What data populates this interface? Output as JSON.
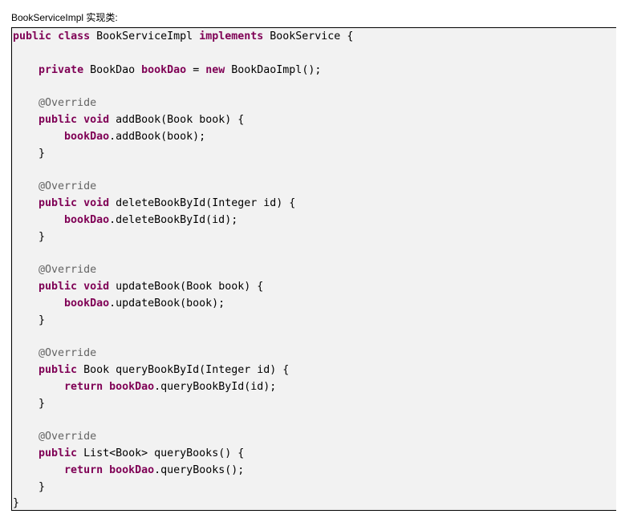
{
  "caption": "BookServiceImpl 实现类:",
  "code": {
    "lines": [
      [
        {
          "t": "public",
          "c": "kw"
        },
        {
          "t": " ",
          "c": "pl"
        },
        {
          "t": "class",
          "c": "kw"
        },
        {
          "t": " BookServiceImpl ",
          "c": "pl"
        },
        {
          "t": "implements",
          "c": "kw"
        },
        {
          "t": " BookService {",
          "c": "pl"
        }
      ],
      [],
      [
        {
          "t": "    ",
          "c": "pl"
        },
        {
          "t": "private",
          "c": "kw"
        },
        {
          "t": " BookDao ",
          "c": "pl"
        },
        {
          "t": "bookDao",
          "c": "fld"
        },
        {
          "t": " = ",
          "c": "pl"
        },
        {
          "t": "new",
          "c": "kw"
        },
        {
          "t": " BookDaoImpl();",
          "c": "pl"
        }
      ],
      [],
      [
        {
          "t": "    ",
          "c": "pl"
        },
        {
          "t": "@Override",
          "c": "ann"
        }
      ],
      [
        {
          "t": "    ",
          "c": "pl"
        },
        {
          "t": "public",
          "c": "kw"
        },
        {
          "t": " ",
          "c": "pl"
        },
        {
          "t": "void",
          "c": "kw"
        },
        {
          "t": " addBook(Book book) {",
          "c": "pl"
        }
      ],
      [
        {
          "t": "        ",
          "c": "pl"
        },
        {
          "t": "bookDao",
          "c": "fld"
        },
        {
          "t": ".addBook(book);",
          "c": "pl"
        }
      ],
      [
        {
          "t": "    }",
          "c": "pl"
        }
      ],
      [],
      [
        {
          "t": "    ",
          "c": "pl"
        },
        {
          "t": "@Override",
          "c": "ann"
        }
      ],
      [
        {
          "t": "    ",
          "c": "pl"
        },
        {
          "t": "public",
          "c": "kw"
        },
        {
          "t": " ",
          "c": "pl"
        },
        {
          "t": "void",
          "c": "kw"
        },
        {
          "t": " deleteBookById(Integer id) {",
          "c": "pl"
        }
      ],
      [
        {
          "t": "        ",
          "c": "pl"
        },
        {
          "t": "bookDao",
          "c": "fld"
        },
        {
          "t": ".deleteBookById(id);",
          "c": "pl"
        }
      ],
      [
        {
          "t": "    }",
          "c": "pl"
        }
      ],
      [],
      [
        {
          "t": "    ",
          "c": "pl"
        },
        {
          "t": "@Override",
          "c": "ann"
        }
      ],
      [
        {
          "t": "    ",
          "c": "pl"
        },
        {
          "t": "public",
          "c": "kw"
        },
        {
          "t": " ",
          "c": "pl"
        },
        {
          "t": "void",
          "c": "kw"
        },
        {
          "t": " updateBook(Book book) {",
          "c": "pl"
        }
      ],
      [
        {
          "t": "        ",
          "c": "pl"
        },
        {
          "t": "bookDao",
          "c": "fld"
        },
        {
          "t": ".updateBook(book);",
          "c": "pl"
        }
      ],
      [
        {
          "t": "    }",
          "c": "pl"
        }
      ],
      [],
      [
        {
          "t": "    ",
          "c": "pl"
        },
        {
          "t": "@Override",
          "c": "ann"
        }
      ],
      [
        {
          "t": "    ",
          "c": "pl"
        },
        {
          "t": "public",
          "c": "kw"
        },
        {
          "t": " Book queryBookById(Integer id) {",
          "c": "pl"
        }
      ],
      [
        {
          "t": "        ",
          "c": "pl"
        },
        {
          "t": "return",
          "c": "kw"
        },
        {
          "t": " ",
          "c": "pl"
        },
        {
          "t": "bookDao",
          "c": "fld"
        },
        {
          "t": ".queryBookById(id);",
          "c": "pl"
        }
      ],
      [
        {
          "t": "    }",
          "c": "pl"
        }
      ],
      [],
      [
        {
          "t": "    ",
          "c": "pl"
        },
        {
          "t": "@Override",
          "c": "ann"
        }
      ],
      [
        {
          "t": "    ",
          "c": "pl"
        },
        {
          "t": "public",
          "c": "kw"
        },
        {
          "t": " List<Book> queryBooks() {",
          "c": "pl"
        }
      ],
      [
        {
          "t": "        ",
          "c": "pl"
        },
        {
          "t": "return",
          "c": "kw"
        },
        {
          "t": " ",
          "c": "pl"
        },
        {
          "t": "bookDao",
          "c": "fld"
        },
        {
          "t": ".queryBooks();",
          "c": "pl"
        }
      ],
      [
        {
          "t": "    }",
          "c": "pl"
        }
      ],
      [
        {
          "t": "}",
          "c": "pl"
        }
      ]
    ]
  }
}
